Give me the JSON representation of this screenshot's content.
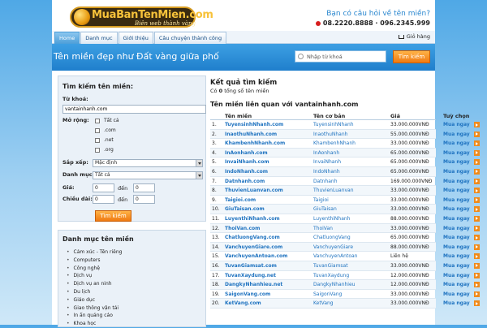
{
  "header": {
    "logo_text": "MuaBanTenMien.com",
    "slogan": "Biên web thành vàng",
    "help_text": "Bạn có câu hỏi về tên miền?",
    "phones": "08.2220.8888 · 096.2345.999"
  },
  "nav": {
    "tabs": [
      {
        "label": "Home",
        "active": true
      },
      {
        "label": "Danh mục",
        "active": false
      },
      {
        "label": "Giới thiệu",
        "active": false
      },
      {
        "label": "Câu chuyện thành công",
        "active": false
      }
    ],
    "cart_label": "Giỏ hàng"
  },
  "banner": {
    "slogan": "Tên miền đẹp như Đất vàng giữa phố",
    "search_placeholder": "Nhập từ khoá",
    "search_button": "Tìm kiếm"
  },
  "search_box": {
    "title": "Tìm kiếm tên miền:",
    "keyword_label": "Từ khoá:",
    "keyword_value": "vantainhanh.com",
    "extension_label": "Mở rộng:",
    "extensions": [
      "Tất cả",
      ".com",
      ".net",
      ".org"
    ],
    "sort_label": "Sắp xếp:",
    "sort_value": "Mặc định",
    "category_label": "Danh mục:",
    "category_value": "Tất cả",
    "price_label": "Giá:",
    "length_label": "Chiều dài:",
    "price_from": "0",
    "price_to": "0",
    "length_from": "0",
    "length_to": "0",
    "to_word": "đến",
    "button": "Tìm kiếm"
  },
  "categories": {
    "title": "Danh mục tên miền",
    "items": [
      "Cảm xúc - Tên riêng",
      "Computers",
      "Công nghệ",
      "Dịch vụ",
      "Dịch vụ an ninh",
      "Du lịch",
      "Giáo dục",
      "Giao thông vận tải",
      "In ấn quảng cáo",
      "Khoa học"
    ]
  },
  "results": {
    "title": "Kết quả tìm kiếm",
    "count_prefix": "Có",
    "count": "0",
    "count_suffix": "tổng số tên miền",
    "related_title": "Tên miền liên quan với vantainhanh.com",
    "columns": {
      "domain": "Tên miền",
      "name": "Tên cơ bản",
      "price": "Giá",
      "action": "Tuỳ chọn"
    },
    "buy_label": "Mua ngay",
    "rows": [
      {
        "idx": "1.",
        "domain": "TuyensinhNhanh.com",
        "name": "TuyensinhNhanh",
        "price": "33.000.000VNĐ"
      },
      {
        "idx": "2.",
        "domain": "InaothuNhanh.com",
        "name": "InaothuNhanh",
        "price": "55.000.000VNĐ"
      },
      {
        "idx": "3.",
        "domain": "KhambenhNhanh.com",
        "name": "KhambenhNhanh",
        "price": "33.000.000VNĐ"
      },
      {
        "idx": "4.",
        "domain": "InAonhanh.com",
        "name": "InAonhanh",
        "price": "65.000.000VNĐ"
      },
      {
        "idx": "5.",
        "domain": "InvaiNhanh.com",
        "name": "InvaiNhanh",
        "price": "65.000.000VNĐ"
      },
      {
        "idx": "6.",
        "domain": "IndoNhanh.com",
        "name": "IndoNhanh",
        "price": "65.000.000VNĐ"
      },
      {
        "idx": "7.",
        "domain": "Datnhanh.com",
        "name": "Datnhanh",
        "price": "169.000.000VNĐ"
      },
      {
        "idx": "8.",
        "domain": "ThuvienLuanvan.com",
        "name": "ThuvienLuanvan",
        "price": "33.000.000VNĐ"
      },
      {
        "idx": "9.",
        "domain": "Taigioi.com",
        "name": "Taigioi",
        "price": "33.000.000VNĐ"
      },
      {
        "idx": "10.",
        "domain": "GiuTaisan.com",
        "name": "GiuTaisan",
        "price": "33.000.000VNĐ"
      },
      {
        "idx": "11.",
        "domain": "LuyenthiNhanh.com",
        "name": "LuyenthiNhanh",
        "price": "88.000.000VNĐ"
      },
      {
        "idx": "12.",
        "domain": "ThoiVan.com",
        "name": "ThoiVan",
        "price": "33.000.000VNĐ"
      },
      {
        "idx": "13.",
        "domain": "ChatluongVang.com",
        "name": "ChatluongVang",
        "price": "65.000.000VNĐ"
      },
      {
        "idx": "14.",
        "domain": "VanchuyenGiare.com",
        "name": "VanchuyenGiare",
        "price": "88.000.000VNĐ"
      },
      {
        "idx": "15.",
        "domain": "VanchuyenAntoan.com",
        "name": "VanchuyenAntoan",
        "price": "Liên hệ"
      },
      {
        "idx": "16.",
        "domain": "TuvanGiamsat.com",
        "name": "TuvanGiamsat",
        "price": "33.000.000VNĐ"
      },
      {
        "idx": "17.",
        "domain": "TuvanXaydung.net",
        "name": "TuvanXaydung",
        "price": "12.000.000VNĐ"
      },
      {
        "idx": "18.",
        "domain": "DangkyNhanhieu.net",
        "name": "DangkyNhanhieu",
        "price": "12.000.000VNĐ"
      },
      {
        "idx": "19.",
        "domain": "SaigonVang.com",
        "name": "SaigonVang",
        "price": "33.000.000VNĐ"
      },
      {
        "idx": "20.",
        "domain": "KetVang.com",
        "name": "KetVang",
        "price": "33.000.000VNĐ"
      }
    ]
  }
}
